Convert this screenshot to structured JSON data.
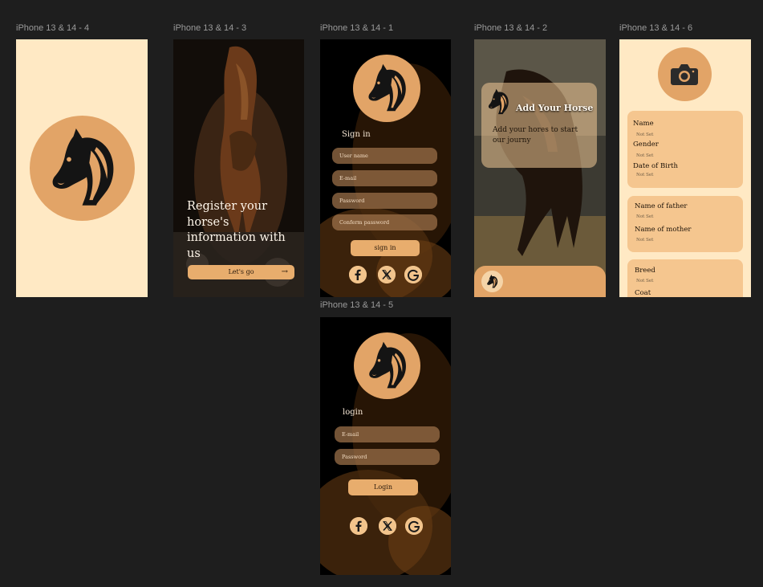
{
  "frames": {
    "f4": {
      "label": "iPhone 13 & 14 - 4"
    },
    "f3": {
      "label": "iPhone 13 & 14 - 3",
      "heading": "Register your horse's information with us",
      "button": "Let's go"
    },
    "f1": {
      "label": "iPhone 13 & 14 - 1",
      "title": "Sign in",
      "fields": [
        "User name",
        "E-mail",
        "Password",
        "Conferm password"
      ],
      "button": "sign in"
    },
    "f2": {
      "label": "iPhone 13 & 14 - 2",
      "card_title": "Add Your Horse",
      "card_text": "Add your hores to start our journy"
    },
    "f6": {
      "label": "iPhone 13 & 14 - 6",
      "card1": [
        {
          "label": "Name",
          "value": "Not Set"
        },
        {
          "label": "Gender",
          "value": "Not Set"
        },
        {
          "label": "Date of Birth",
          "value": "Not Set"
        }
      ],
      "card2": [
        {
          "label": "Name of father",
          "value": "Not Set"
        },
        {
          "label": "Name of mother",
          "value": "Not Set"
        }
      ],
      "card3": [
        {
          "label": "Breed",
          "value": "Not Set"
        },
        {
          "label": "Coat",
          "value": ""
        }
      ]
    },
    "f5": {
      "label": "iPhone 13 & 14 - 5",
      "title": "login",
      "fields": [
        "E-mail",
        "Password"
      ],
      "button": "Login"
    }
  },
  "social_icons": [
    "facebook-icon",
    "x-icon",
    "google-icon"
  ],
  "colors": {
    "canvas": "#1e1e1e",
    "cream": "#ffe9c4",
    "tan": "#e2a467",
    "field": "#a0734b",
    "button": "#e8ad6d"
  }
}
